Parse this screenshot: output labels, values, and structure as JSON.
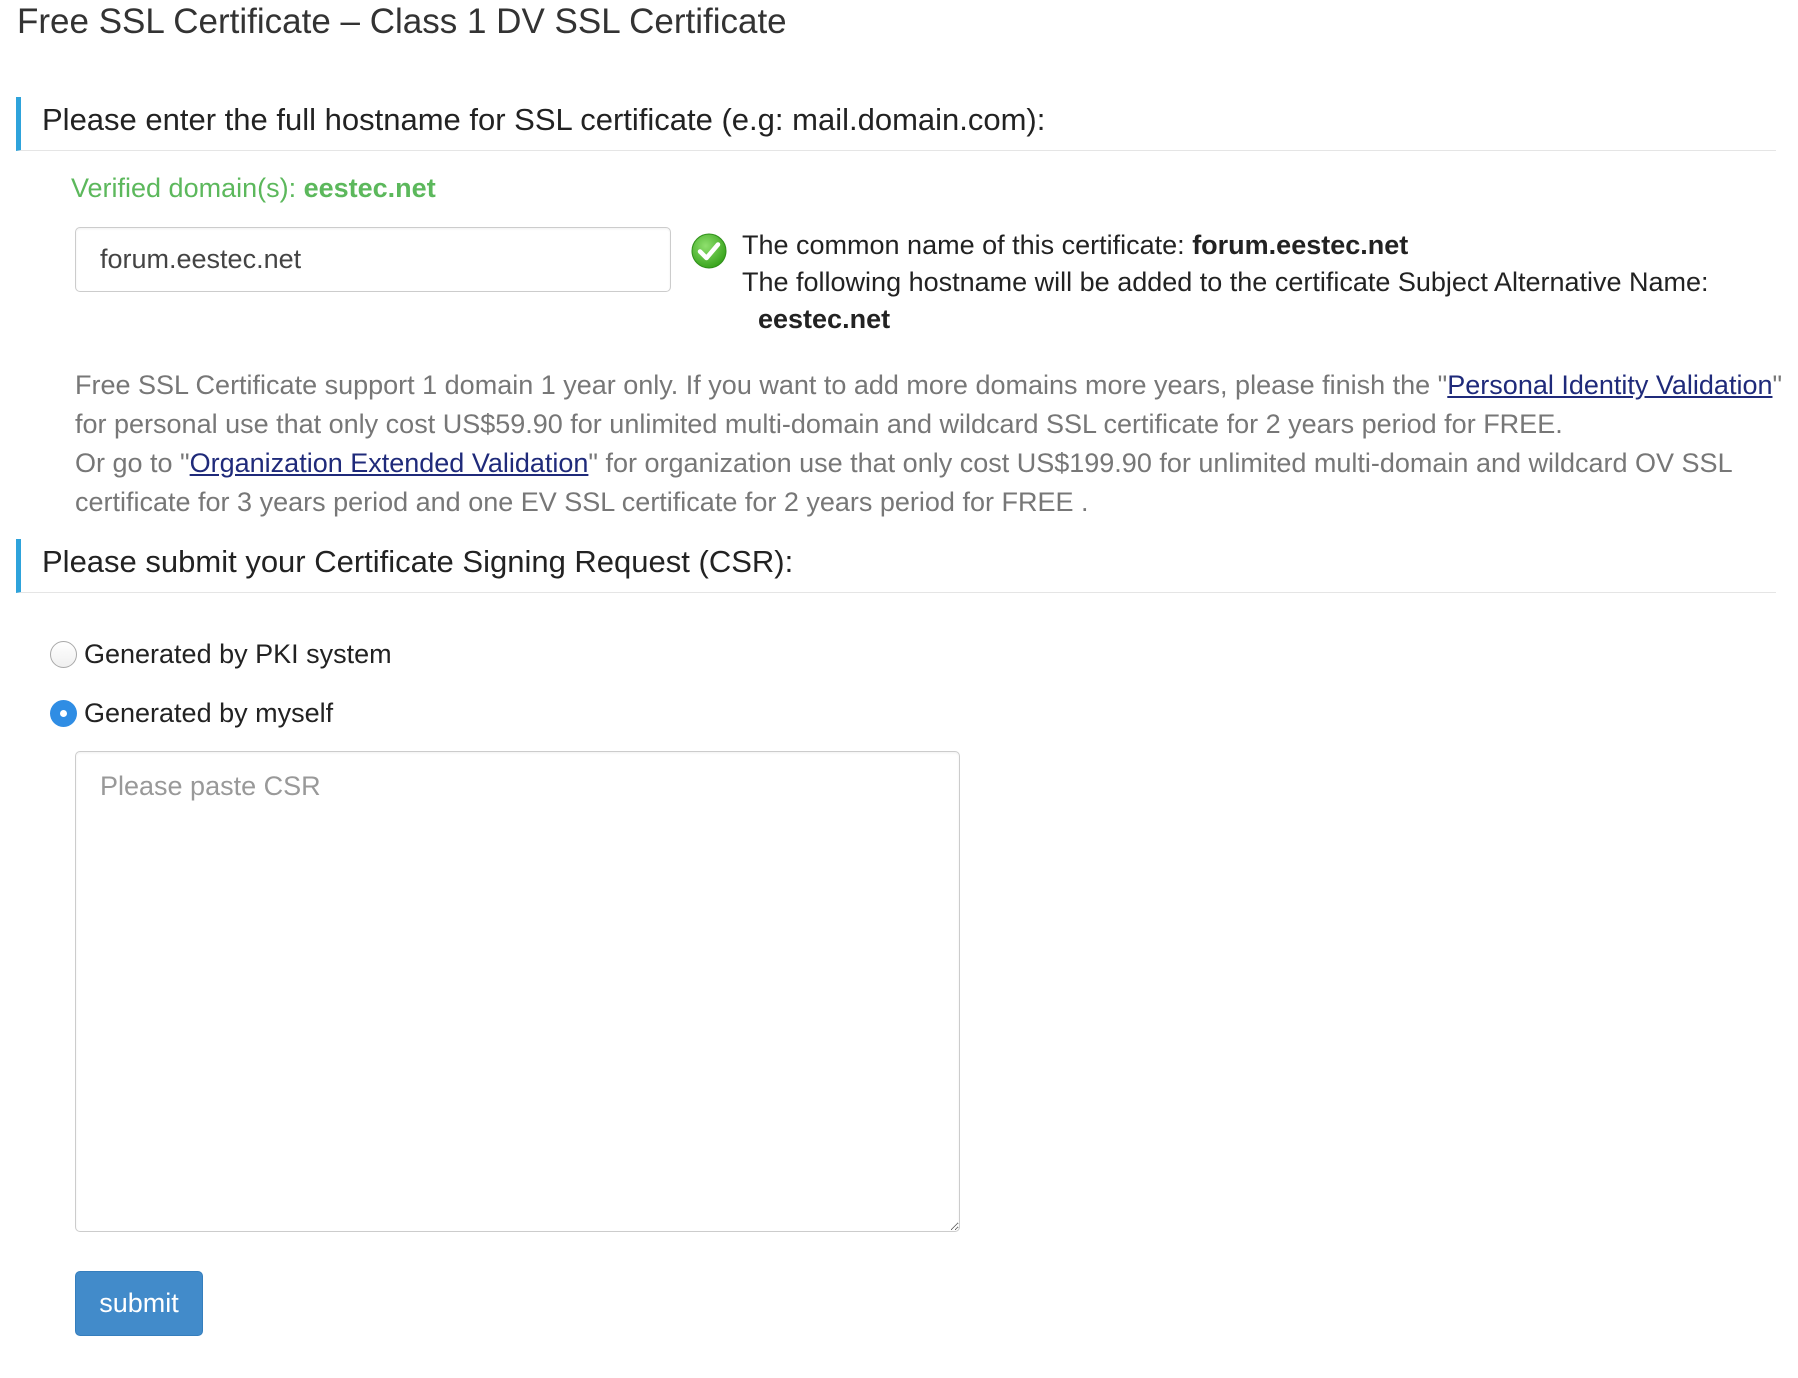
{
  "page": {
    "title": "Free SSL Certificate – Class 1 DV SSL Certificate"
  },
  "hostname_section": {
    "heading": "Please enter the full hostname for SSL certificate (e.g: mail.domain.com):",
    "verified_label": "Verified domain(s): ",
    "verified_domain": "eestec.net",
    "input_value": "forum.eestec.net",
    "common_name_label": "The common name of this certificate: ",
    "common_name_value": "forum.eestec.net",
    "san_label": "The following hostname will be added to the certificate Subject Alternative Name:",
    "san_value": "eestec.net",
    "check_icon": "check-circle-icon"
  },
  "info": {
    "line1_text": "Free SSL Certificate support 1 domain 1 year only. If you want to add more domains more years, please finish the \"",
    "personal_link": "Personal Identity Validation",
    "line1_end": "\"",
    "line2_text": "for personal use that only cost US$59.90 for unlimited multi-domain and wildcard SSL certificate for 2 years period for FREE.",
    "line3_start": "Or go to \"",
    "org_link": "Organization Extended Validation",
    "line3_end": "\" for organization use that only cost US$199.90 for unlimited multi-domain and wildcard OV SSL",
    "line4_text": "certificate for 3 years period and one EV SSL certificate for 2 years period for FREE ."
  },
  "csr_section": {
    "heading": "Please submit your Certificate Signing Request (CSR):",
    "options": [
      {
        "label": "Generated by PKI system",
        "selected": false
      },
      {
        "label": "Generated by myself",
        "selected": true
      }
    ],
    "textarea_value": "",
    "textarea_placeholder": "Please paste CSR",
    "submit_label": "submit"
  },
  "colors": {
    "accent_bar": "#2ea3db",
    "verified_green": "#5cb85c",
    "button_blue": "#428bca",
    "radio_selected": "#2f8de4",
    "link": "#1f2a7a"
  }
}
